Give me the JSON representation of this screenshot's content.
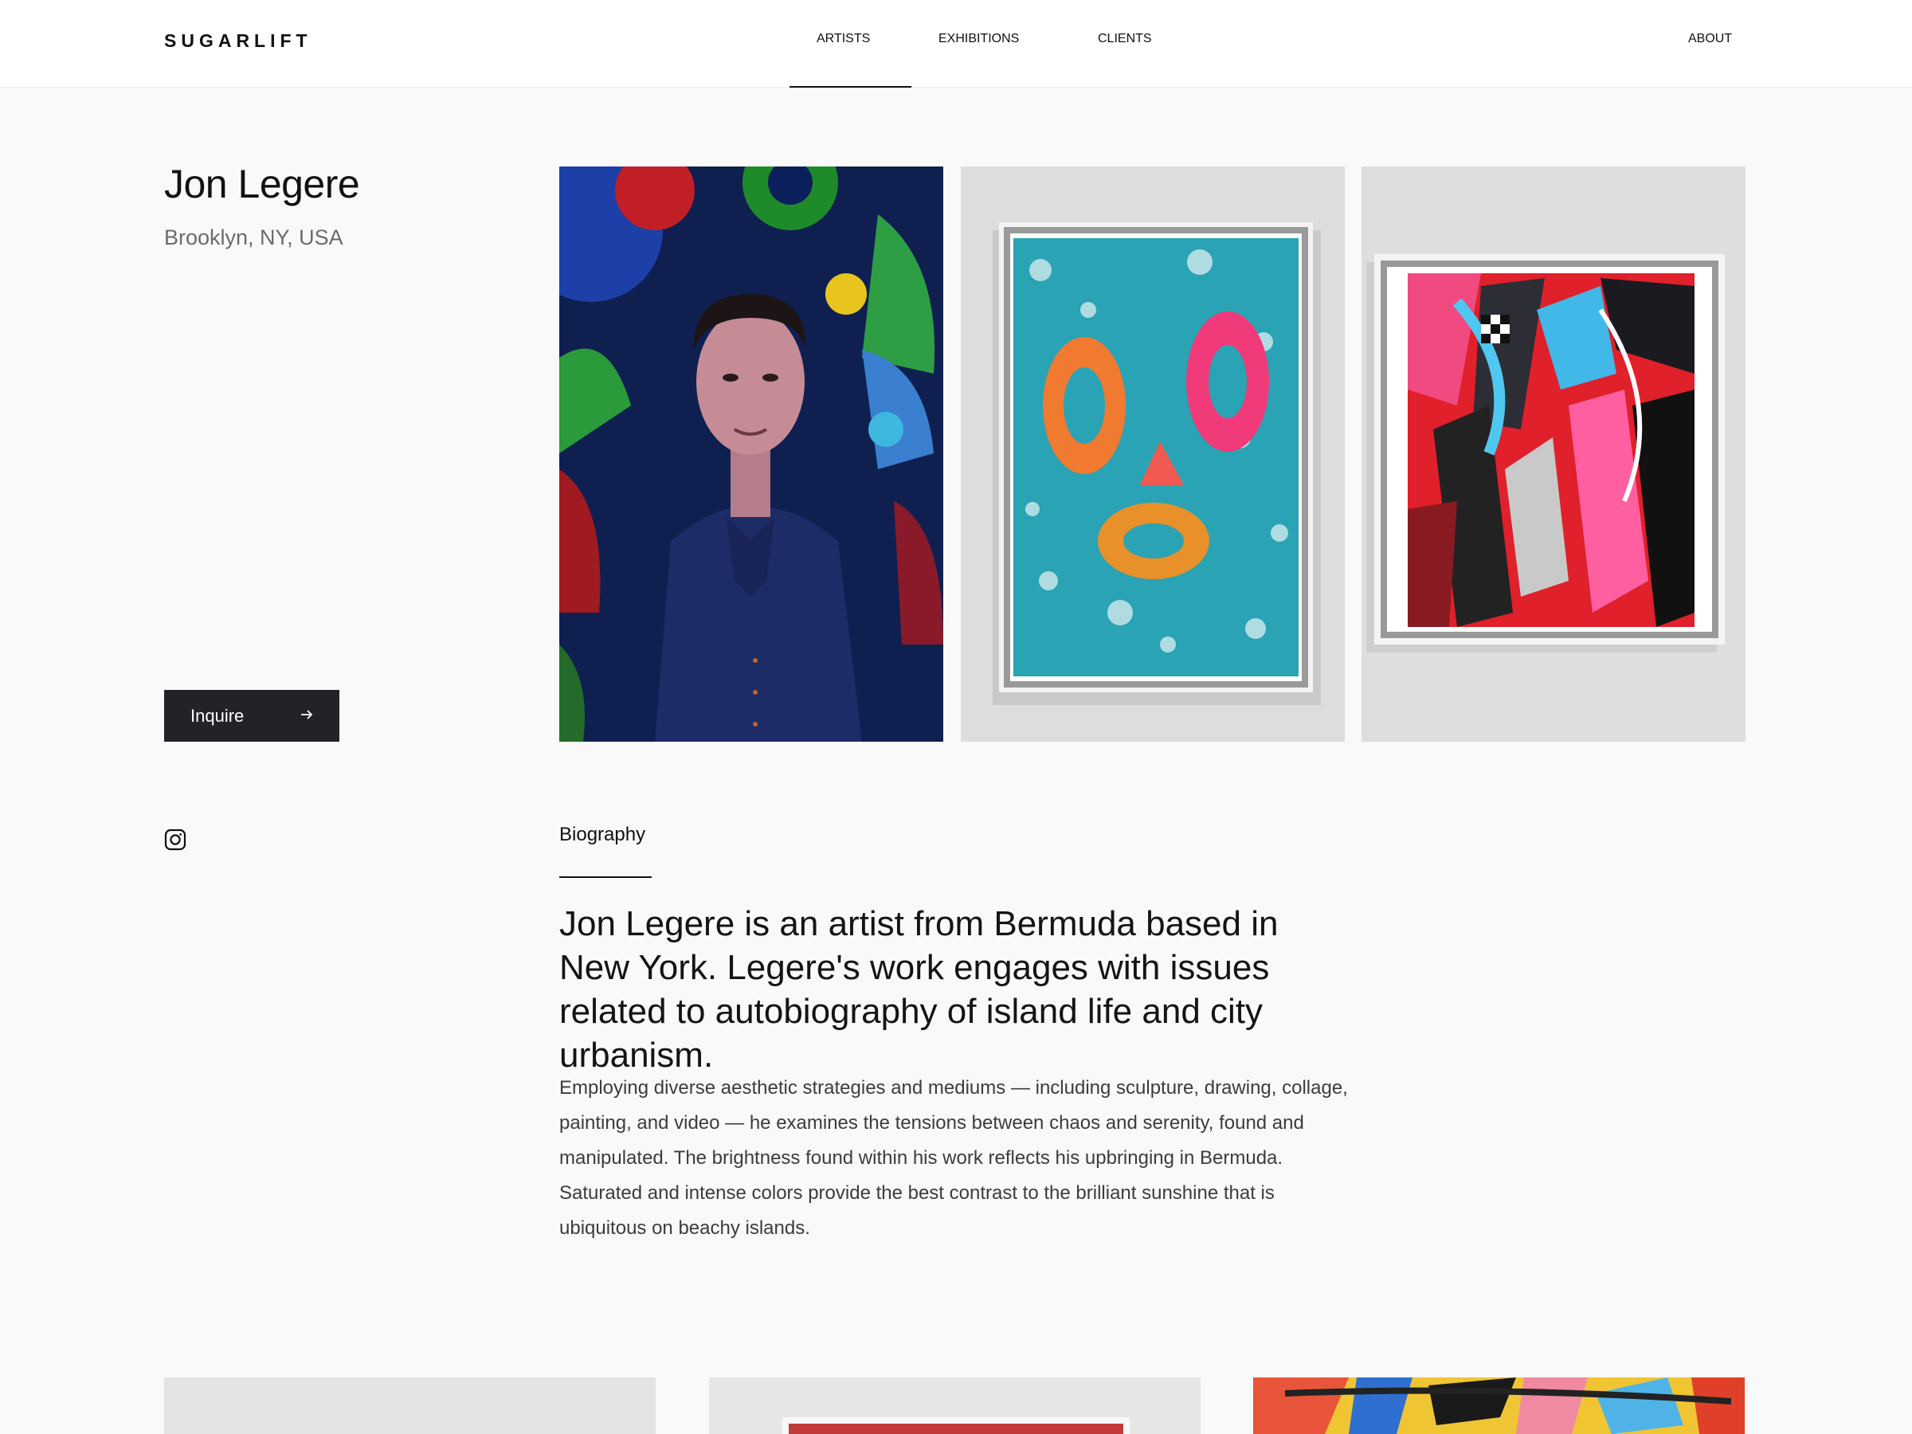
{
  "header": {
    "logo": "SUGARLIFT",
    "nav": [
      {
        "label": "ARTISTS",
        "active": true
      },
      {
        "label": "EXHIBITIONS",
        "active": false
      },
      {
        "label": "CLIENTS",
        "active": false
      }
    ],
    "about": "ABOUT"
  },
  "artist": {
    "name": "Jon Legere",
    "location": "Brooklyn, NY, USA",
    "inquire_label": "Inquire",
    "inquire_icon": "arrow-right-icon",
    "social_icon": "instagram-icon"
  },
  "gallery": [
    {
      "kind": "artist-portrait"
    },
    {
      "kind": "framed-artwork-face"
    },
    {
      "kind": "framed-artwork-collage"
    }
  ],
  "biography": {
    "label": "Biography",
    "lead": "Jon Legere is an artist from Bermuda based in New York. Legere's work engages with issues related to autobiography of island life and city urbanism.",
    "body": "Employing diverse aesthetic strategies and mediums — including sculpture, drawing, collage, painting, and video — he examines the tensions between chaos and serenity, found and manipulated. The brightness found within his work reflects his upbringing in Bermuda. Saturated and intense colors provide the best contrast to the brilliant sunshine that is ubiquitous on beachy islands."
  },
  "colors": {
    "background": "#f9f9f9",
    "button": "#222327",
    "text": "#111111",
    "muted": "#6b6b6b"
  }
}
